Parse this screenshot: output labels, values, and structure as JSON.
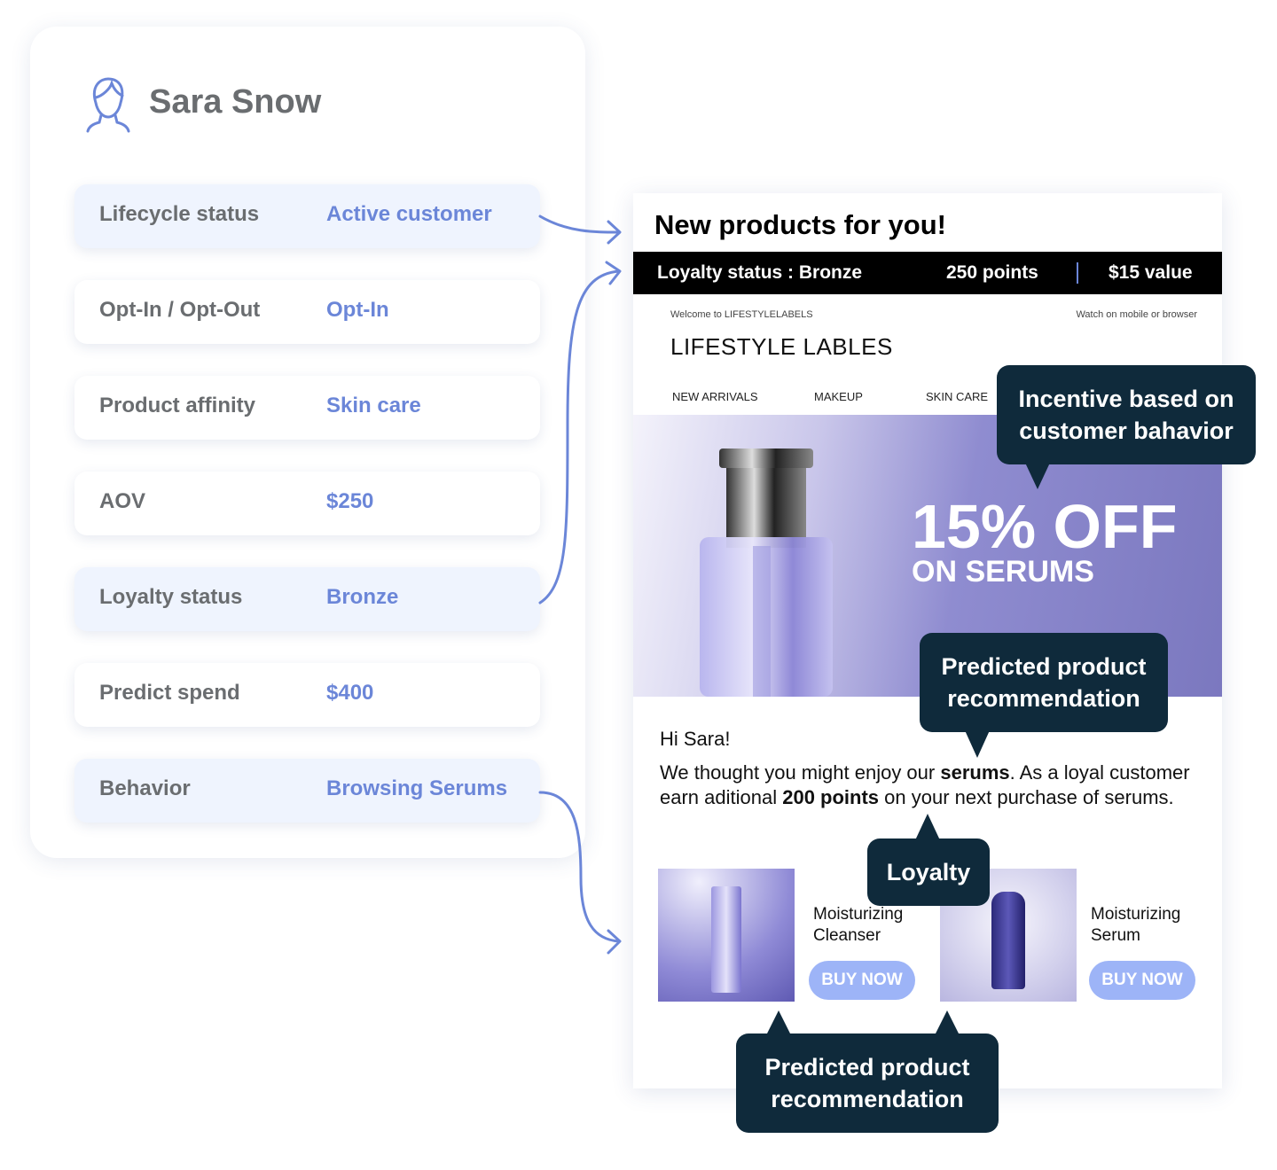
{
  "profile": {
    "name": "Sara Snow",
    "avatar_icon": "user-outline-icon",
    "rows": [
      {
        "label": "Lifecycle status",
        "value": "Active customer"
      },
      {
        "label": "Opt-In / Opt-Out",
        "value": "Opt-In"
      },
      {
        "label": "Product affinity",
        "value": "Skin care"
      },
      {
        "label": "AOV",
        "value": "$250"
      },
      {
        "label": "Loyalty status",
        "value": "Bronze"
      },
      {
        "label": "Predict spend",
        "value": "$400"
      },
      {
        "label": "Behavior",
        "value": "Browsing Serums"
      }
    ]
  },
  "email": {
    "title": "New products for you!",
    "loyalty_bar": {
      "status": "Loyalty status : Bronze",
      "points": "250 points",
      "value": "$15 value"
    },
    "welcome": "Welcome to LIFESTYLELABELS",
    "watch": "Watch on mobile or browser",
    "logo": "LIFESTYLE LABLES",
    "nav": [
      "NEW ARRIVALS",
      "MAKEUP",
      "SKIN CARE"
    ],
    "hero": {
      "headline": "15% OFF",
      "sub": "ON SERUMS"
    },
    "greeting": "Hi Sara!",
    "body": {
      "t1": "We thought you might enjoy our ",
      "b1": "serums",
      "t2": ". As a loyal customer earn aditional ",
      "b2": "200 points",
      "t3": " on your next purchase of serums."
    },
    "products": [
      {
        "name1": "Moisturizing",
        "name2": "Cleanser",
        "button": "BUY NOW"
      },
      {
        "name1": "Moisturizing",
        "name2": "Serum",
        "button": "BUY NOW"
      }
    ]
  },
  "callouts": {
    "incentive": "Incentive based on customer bahavior",
    "predicted1": "Predicted product recommendation",
    "loyalty": "Loyalty",
    "predicted2": "Predicted product recommendation"
  },
  "colors": {
    "accent": "#6b86d8",
    "callout": "#0f2a3b",
    "button": "#9db4f7",
    "row_alt": "#eff4fe"
  }
}
